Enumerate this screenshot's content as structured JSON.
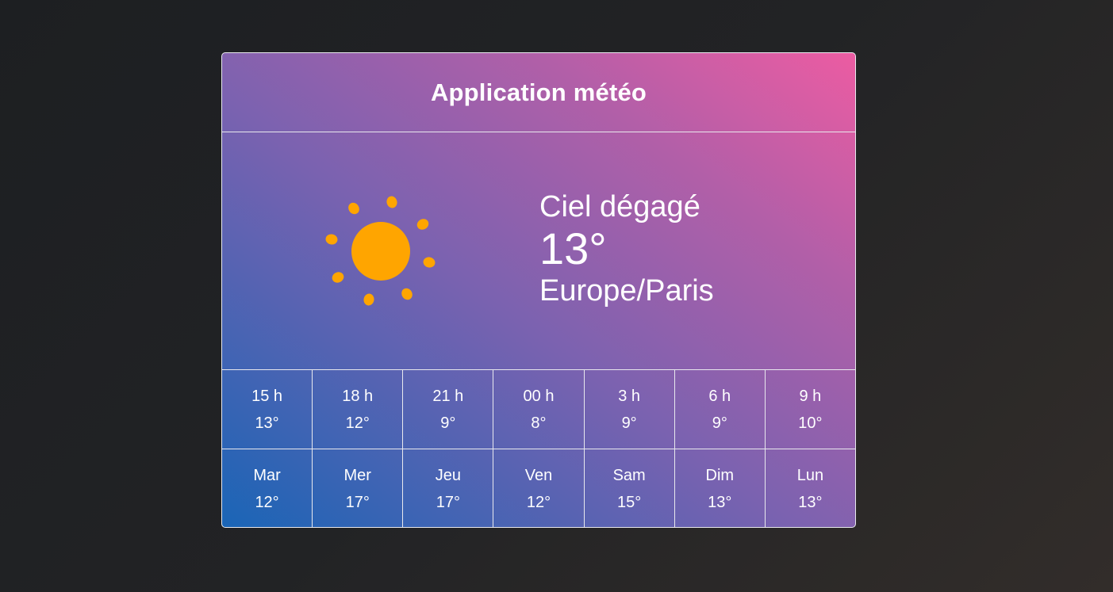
{
  "app": {
    "title": "Application météo"
  },
  "current": {
    "icon": "sun-icon",
    "description": "Ciel dégagé",
    "temperature": "13°",
    "timezone": "Europe/Paris"
  },
  "hourly": [
    {
      "time": "15 h",
      "temp": "13°"
    },
    {
      "time": "18 h",
      "temp": "12°"
    },
    {
      "time": "21 h",
      "temp": "9°"
    },
    {
      "time": "00 h",
      "temp": "8°"
    },
    {
      "time": "3 h",
      "temp": "9°"
    },
    {
      "time": "6 h",
      "temp": "9°"
    },
    {
      "time": "9 h",
      "temp": "10°"
    }
  ],
  "daily": [
    {
      "day": "Mar",
      "temp": "12°"
    },
    {
      "day": "Mer",
      "temp": "17°"
    },
    {
      "day": "Jeu",
      "temp": "17°"
    },
    {
      "day": "Ven",
      "temp": "12°"
    },
    {
      "day": "Sam",
      "temp": "15°"
    },
    {
      "day": "Dim",
      "temp": "13°"
    },
    {
      "day": "Lun",
      "temp": "13°"
    }
  ],
  "colors": {
    "sun": "#ffa500",
    "border": "#e9e9ee",
    "gradient_start": "#1a65b6",
    "gradient_end": "#ec5ca2"
  }
}
